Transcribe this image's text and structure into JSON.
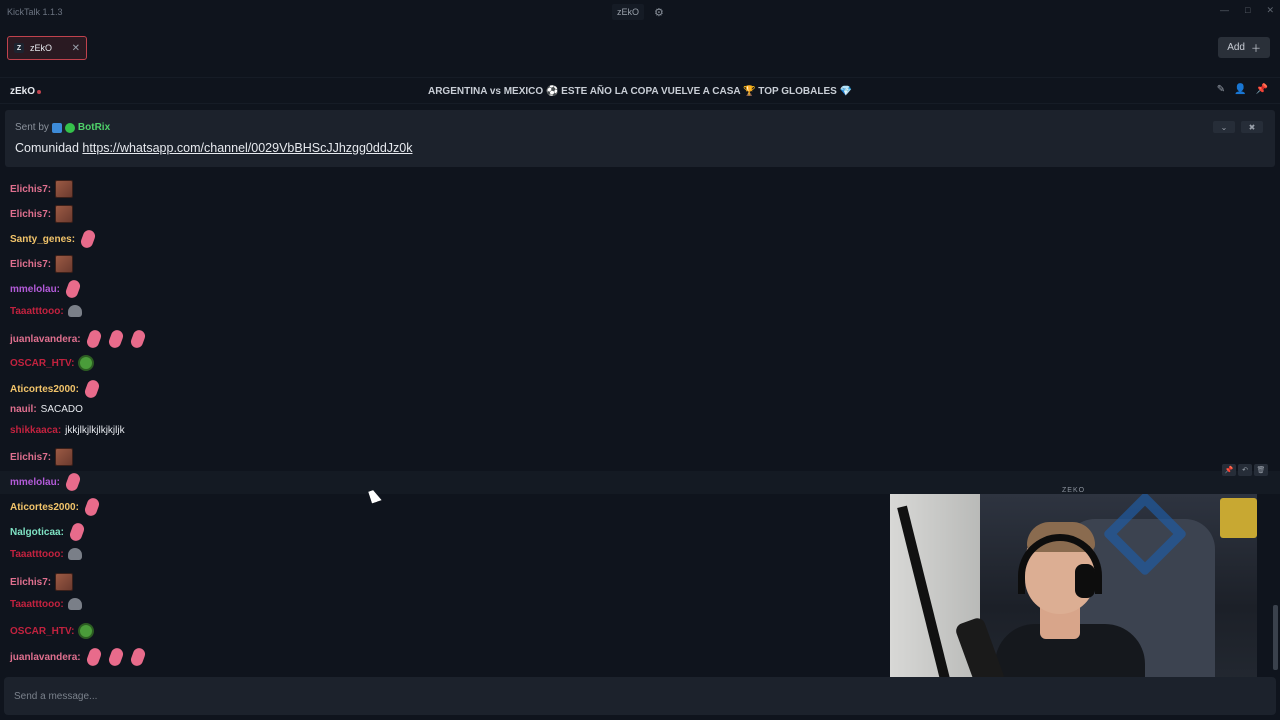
{
  "app": {
    "title": "KickTalk 1.1.3"
  },
  "titlebar": {
    "channel": "zEkO"
  },
  "tabs": [
    {
      "label": "zEkO",
      "icon": "Z"
    }
  ],
  "add_button": {
    "label": "Add"
  },
  "channel_header": {
    "name": "zEkO",
    "stream_title": "ARGENTINA vs MEXICO ⚽ ESTE AÑO LA COPA VUELVE A CASA 🏆 TOP GLOBALES 💎"
  },
  "pinned": {
    "sent_by_label": "Sent by",
    "bot_name": "BotRix",
    "message_prefix": "Comunidad",
    "link": "https://whatsapp.com/channel/0029VbBHScJJhzgg0ddJz0k"
  },
  "chat": [
    {
      "user": "Elichis7:",
      "color": "#e0708f",
      "emotes": [
        "face"
      ],
      "text": ""
    },
    {
      "user": "Elichis7:",
      "color": "#e0708f",
      "emotes": [
        "face"
      ],
      "text": ""
    },
    {
      "user": "Santy_genes:",
      "color": "#f2c46a",
      "emotes": [
        "bean"
      ],
      "text": ""
    },
    {
      "user": "Elichis7:",
      "color": "#e0708f",
      "emotes": [
        "face"
      ],
      "text": ""
    },
    {
      "user": "mmelolau:",
      "color": "#b35bd9",
      "emotes": [
        "bean"
      ],
      "text": ""
    },
    {
      "user": "Taaatttooo:",
      "color": "#c2223f",
      "emotes": [
        "rat"
      ],
      "text": ""
    },
    {
      "user": "juanlavandera:",
      "color": "#e0708f",
      "emotes": [
        "bean",
        "bean",
        "bean"
      ],
      "text": ""
    },
    {
      "user": "OSCAR_HTV:",
      "color": "#c2223f",
      "emotes": [
        "pepe"
      ],
      "text": ""
    },
    {
      "user": "Aticortes2000:",
      "color": "#f2c46a",
      "emotes": [
        "bean"
      ],
      "text": ""
    },
    {
      "user": "nauil:",
      "color": "#e0708f",
      "emotes": [],
      "text": "SACADO"
    },
    {
      "user": "shikkaaca:",
      "color": "#c2223f",
      "emotes": [],
      "text": "jkkjlkjlkjlkjkjljk"
    },
    {
      "user": "Elichis7:",
      "color": "#e0708f",
      "emotes": [
        "face"
      ],
      "text": ""
    },
    {
      "user": "mmelolau:",
      "color": "#b35bd9",
      "emotes": [
        "bean"
      ],
      "text": ""
    },
    {
      "user": "Aticortes2000:",
      "color": "#f2c46a",
      "emotes": [
        "bean"
      ],
      "text": ""
    },
    {
      "user": "Nalgoticaa:",
      "color": "#7fe3c4",
      "emotes": [
        "bean"
      ],
      "text": ""
    },
    {
      "user": "Taaatttooo:",
      "color": "#c2223f",
      "emotes": [
        "rat"
      ],
      "text": ""
    },
    {
      "user": "Elichis7:",
      "color": "#e0708f",
      "emotes": [
        "face"
      ],
      "text": ""
    },
    {
      "user": "Taaatttooo:",
      "color": "#c2223f",
      "emotes": [
        "rat"
      ],
      "text": ""
    },
    {
      "user": "OSCAR_HTV:",
      "color": "#c2223f",
      "emotes": [
        "pepe"
      ],
      "text": ""
    },
    {
      "user": "juanlavandera:",
      "color": "#e0708f",
      "emotes": [
        "bean",
        "bean",
        "bean"
      ],
      "text": ""
    }
  ],
  "video": {
    "label": "ZEKO"
  },
  "composer": {
    "placeholder": "Send a message..."
  }
}
